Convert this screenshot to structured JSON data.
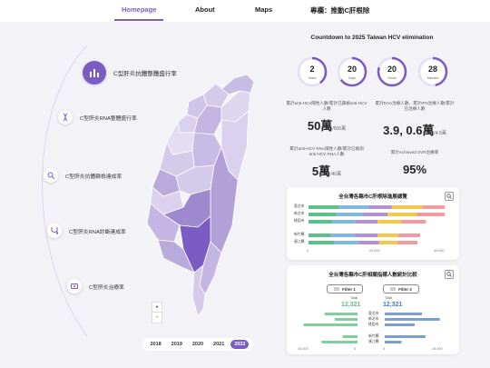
{
  "nav": {
    "home": "Homepage",
    "about": "About",
    "maps": "Maps",
    "special": "專欄：推動C肝根除"
  },
  "side_menu": [
    {
      "label": "C型肝炎抗體整體盛行率",
      "icon": "bar-chart-icon"
    },
    {
      "label": "C型肝炎RNA整體盛行率",
      "icon": "dna-icon"
    },
    {
      "label": "C型肝炎抗體篩檢達成率",
      "icon": "magnifier-icon"
    },
    {
      "label": "C型肝炎RNA診斷達成率",
      "icon": "stethoscope-icon"
    },
    {
      "label": "C型肝炎治療率",
      "icon": "pill-box-icon"
    }
  ],
  "zoom": {
    "in": "+",
    "out": "-"
  },
  "years": [
    "2018",
    "2019",
    "2020",
    "2021",
    "2022"
  ],
  "active_year": "2022",
  "countdown": {
    "title": "Countdown to 2025 Taiwan HCV elimination",
    "items": [
      {
        "value": "2",
        "unit": "Years",
        "fraction": 0.4
      },
      {
        "value": "20",
        "unit": "Days",
        "fraction": 0.65
      },
      {
        "value": "20",
        "unit": "Hours",
        "fraction": 0.8
      },
      {
        "value": "28",
        "unit": "Minutes",
        "fraction": 0.47
      }
    ]
  },
  "stats": [
    {
      "caption": "累計anti-HCV陽性人數/累計已篩檢anti-HCV人數",
      "value": "50萬",
      "sub": "/500萬"
    },
    {
      "caption": "累計DAA治療人數，累計IFN治療人數/累計已治療人數",
      "value": "3.9, 0.6萬",
      "sub": "/4.5萬"
    },
    {
      "caption": "累計anti-HCV RNA陽性人數/累計已檢測anti-HCV RNA人數",
      "value": "5萬",
      "sub": "/40萬"
    },
    {
      "caption": "累計Achieved SVR治療率",
      "value": "95%",
      "sub": ""
    }
  ],
  "chart1": {
    "title": "全台灣各縣市C肝根除進展總覽",
    "rows": [
      "臺北市",
      "新北市",
      "桃園市",
      "新竹縣",
      "連江縣"
    ],
    "ticks": [
      "0",
      "20,000",
      "40,000"
    ],
    "colors": [
      "#5bc08a",
      "#7fb9e0",
      "#b38fd8",
      "#f2c94c",
      "#f19aa2"
    ],
    "series": [
      [
        9000,
        8000,
        7000,
        6500,
        7500
      ],
      [
        8500,
        7800,
        6800,
        7000,
        7200
      ],
      [
        7000,
        7500,
        6500,
        6800,
        6000
      ],
      [
        9000,
        8500,
        7000,
        6000,
        5500
      ],
      [
        8800,
        8200,
        7200,
        6500,
        5800
      ]
    ],
    "max": 40000
  },
  "chart2": {
    "title": "全台灣各縣市C肝相關指標人數統計比較",
    "filter1": "Filter 1",
    "filter2": "Filter 2",
    "total_label": "Total",
    "left_total": "12,321",
    "right_total": "12,321",
    "left_color": "#7fcf9a",
    "right_color": "#7b9fd0",
    "rows": [
      "臺北市",
      "新北市",
      "桃園市",
      "新竹縣",
      "連江縣"
    ],
    "left_values": [
      5500,
      3800,
      9000,
      2500,
      6000
    ],
    "right_values": [
      6200,
      9200,
      5000,
      6800,
      2800
    ],
    "ticks_left": [
      "10,000",
      "0"
    ],
    "ticks_right": [
      "0",
      "10,000"
    ],
    "max": 10000
  }
}
